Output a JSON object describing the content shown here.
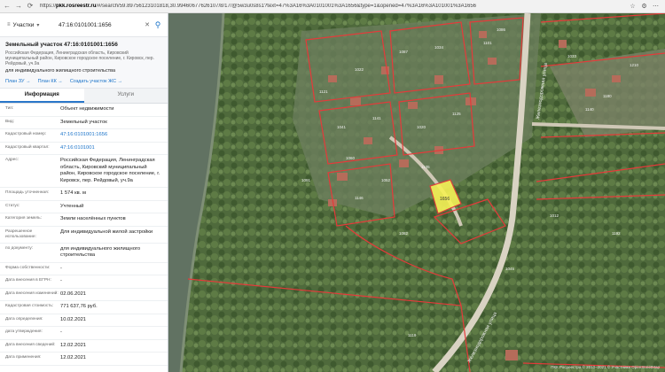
{
  "browser": {
    "url_prefix": "https://",
    "url_host": "pkk.rosreestr.ru",
    "url_rest": "/#/search/59.89756123101818,30.99460677626107/8/17/@5w3u0s8s1?text=47%3A16%3A0101001%3A1656&type=1&opened=47%3A16%3A101001%3A1656"
  },
  "search": {
    "category": "Участки",
    "value": "47:16:0101001:1656"
  },
  "card": {
    "title": "Земельный участок 47:16:0101001:1656",
    "address": "Российская Федерация, Ленинградская область, Кировский муниципальный район, Кировское городское поселение, г. Кировск, пер. Рейдовый, уч.9а",
    "use": "для индивидуального жилищного строительства",
    "links": [
      "План ЗУ →",
      "План КК →",
      "Создать участок ЖС →"
    ]
  },
  "tabs": [
    "Информация",
    "Услуги"
  ],
  "rows": [
    {
      "k": "Тип:",
      "v": "Объект недвижимости"
    },
    {
      "k": "Вид:",
      "v": "Земельный участок"
    },
    {
      "k": "Кадастровый номер:",
      "v": "47:16:0101001:1656",
      "link": true
    },
    {
      "k": "Кадастровый квартал:",
      "v": "47:16:0101001",
      "link": true
    },
    {
      "k": "Адрес:",
      "v": "Российская Федерация, Ленинградская область, Кировский муниципальный район, Кировское городское поселение, г. Кировск, пер. Рейдовый, уч.9а"
    },
    {
      "k": "Площадь уточненная:",
      "v": "1 574 кв. м"
    },
    {
      "k": "Статус:",
      "v": "Учтенный"
    },
    {
      "k": "Категория земель:",
      "v": "Земли населённых пунктов"
    },
    {
      "k": "Разрешенное использование:",
      "v": "Для индивидуальной жилой застройки"
    },
    {
      "k": "по документу:",
      "v": "для индивидуального жилищного строительства"
    },
    {
      "k": "Форма собственности:",
      "v": "-"
    },
    {
      "k": "Дата внесения в ЕГРН:",
      "v": "-"
    },
    {
      "k": "Дата внесения изменений:",
      "v": "02.06.2021"
    },
    {
      "k": "Кадастровая стоимость:",
      "v": "771 637,76 руб."
    },
    {
      "k": "Дата определения:",
      "v": "10.02.2021"
    },
    {
      "k": "дата утверждения:",
      "v": "-"
    },
    {
      "k": "Дата внесения сведений:",
      "v": "12.02.2021"
    },
    {
      "k": "Дата применения:",
      "v": "12.02.2021"
    }
  ],
  "map": {
    "plot_label": "1656",
    "street_1": "Железнодорожная улица",
    "street_2": "Железнодорожная улица",
    "parcel_labels": [
      "1121",
      "1022",
      "1087",
      "1034",
      "1101",
      "1041",
      "1141",
      "1020",
      "1125",
      "1060",
      "1052",
      "1135",
      "1146",
      "1086",
      "1033",
      "1180",
      "1210",
      "1140",
      "1091",
      "1082",
      "1012",
      "1045",
      "1119",
      "1192"
    ],
    "attribution": "ПКК Росреестра © 2010–2021 © Участники OpenStreetMap"
  },
  "colors": {
    "boundary": "#e53a3a",
    "plot_fill": "#f6f256",
    "water": "#606f60"
  }
}
